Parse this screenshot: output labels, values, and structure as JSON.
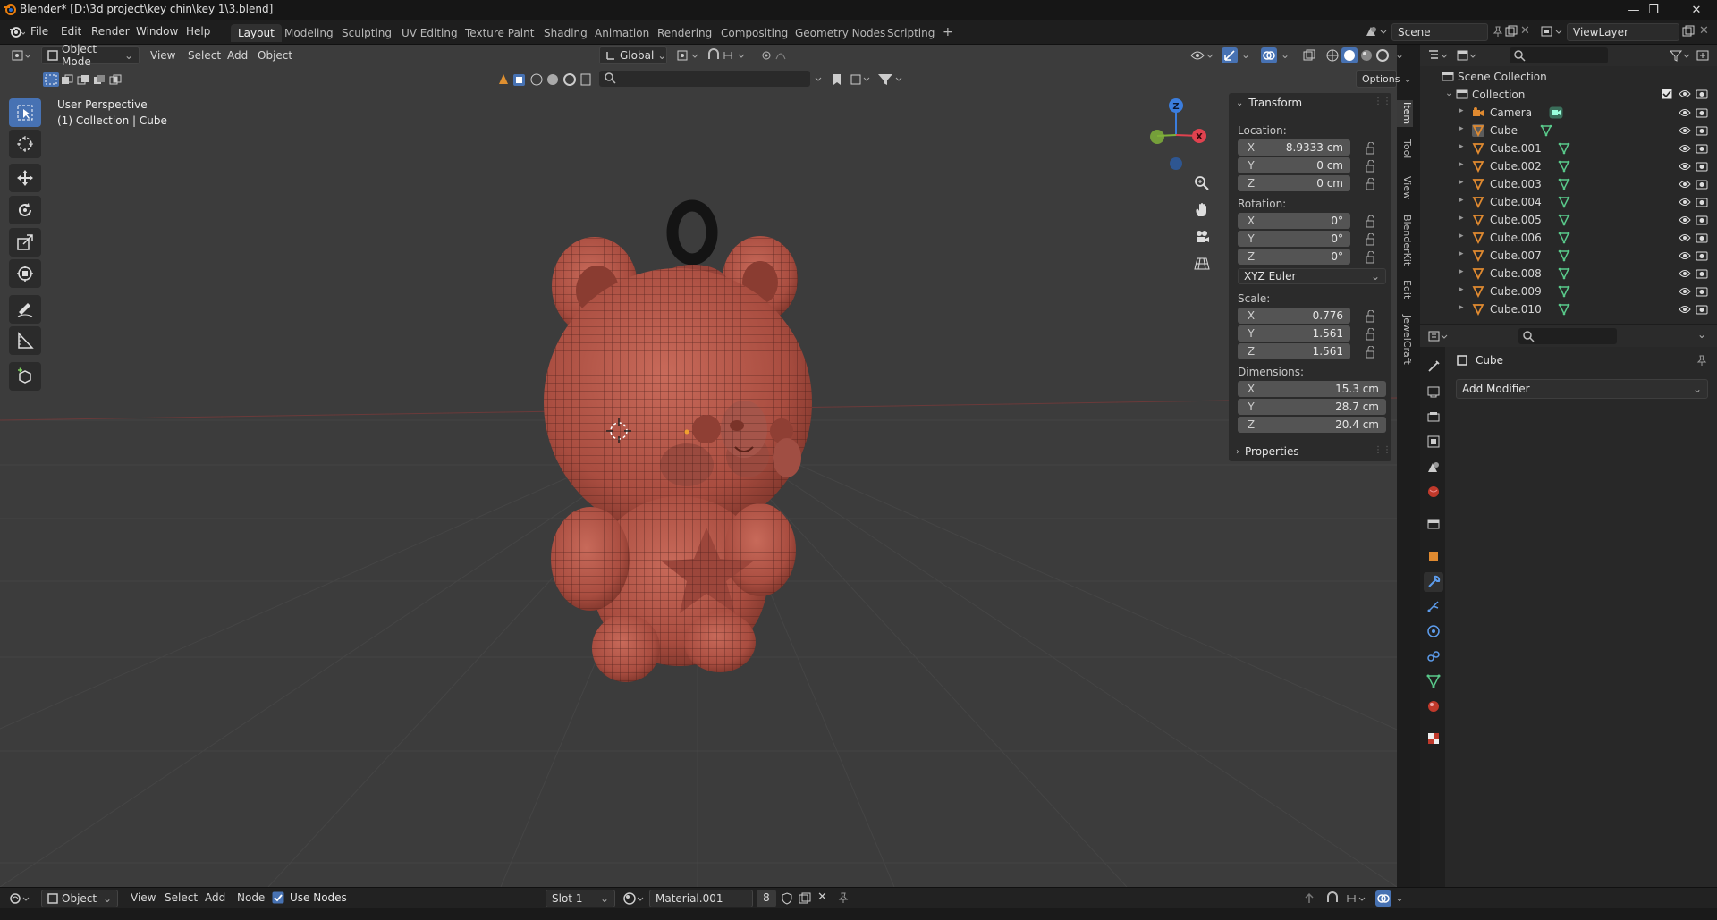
{
  "window": {
    "title": "Blender* [D:\\3d project\\key chin\\key 1\\3.blend]"
  },
  "menu": [
    "File",
    "Edit",
    "Render",
    "Window",
    "Help"
  ],
  "workspaces": [
    "Layout",
    "Modeling",
    "Sculpting",
    "UV Editing",
    "Texture Paint",
    "Shading",
    "Animation",
    "Rendering",
    "Compositing",
    "Geometry Nodes",
    "Scripting"
  ],
  "active_workspace": "Layout",
  "scene": {
    "name": "Scene",
    "view_layer": "ViewLayer"
  },
  "viewport": {
    "mode": "Object Mode",
    "menus": [
      "View",
      "Select",
      "Add",
      "Object"
    ],
    "orientation": "Global",
    "options_label": "Options",
    "perspective_label": "User Perspective",
    "collection_label": "(1) Collection | Cube",
    "gizmo_axes": {
      "x": "X",
      "y": "Y",
      "z": "Z"
    }
  },
  "npanel": {
    "header": "Transform",
    "location_label": "Location:",
    "location": [
      {
        "axis": "X",
        "value": "8.9333 cm"
      },
      {
        "axis": "Y",
        "value": "0 cm"
      },
      {
        "axis": "Z",
        "value": "0 cm"
      }
    ],
    "rotation_label": "Rotation:",
    "rotation": [
      {
        "axis": "X",
        "value": "0°"
      },
      {
        "axis": "Y",
        "value": "0°"
      },
      {
        "axis": "Z",
        "value": "0°"
      }
    ],
    "rotation_mode": "XYZ Euler",
    "scale_label": "Scale:",
    "scale": [
      {
        "axis": "X",
        "value": "0.776"
      },
      {
        "axis": "Y",
        "value": "1.561"
      },
      {
        "axis": "Z",
        "value": "1.561"
      }
    ],
    "dimensions_label": "Dimensions:",
    "dimensions": [
      {
        "axis": "X",
        "value": "15.3 cm"
      },
      {
        "axis": "Y",
        "value": "28.7 cm"
      },
      {
        "axis": "Z",
        "value": "20.4 cm"
      }
    ],
    "properties_label": "Properties",
    "side_tabs": [
      "Item",
      "Tool",
      "View",
      "BlenderKit",
      "Edit",
      "JewelCraft"
    ]
  },
  "outliner": {
    "scene_collection": "Scene Collection",
    "collection": "Collection",
    "items": [
      "Camera",
      "Cube",
      "Cube.001",
      "Cube.002",
      "Cube.003",
      "Cube.004",
      "Cube.005",
      "Cube.006",
      "Cube.007",
      "Cube.008",
      "Cube.009",
      "Cube.010"
    ]
  },
  "properties": {
    "object_name": "Cube",
    "add_modifier": "Add Modifier"
  },
  "bottom_bar": {
    "editor_type": "Object",
    "menus": [
      "View",
      "Select",
      "Add",
      "Node"
    ],
    "use_nodes": "Use Nodes",
    "slot": "Slot 1",
    "material": "Material.001",
    "user_count": "8"
  },
  "colors": {
    "accent": "#4772b3",
    "model": "#b5584a",
    "viewport_bg": "#3c3c3c",
    "axis_x": "#e0424f",
    "axis_y": "#7fb03a",
    "axis_z": "#3b7ddd"
  }
}
